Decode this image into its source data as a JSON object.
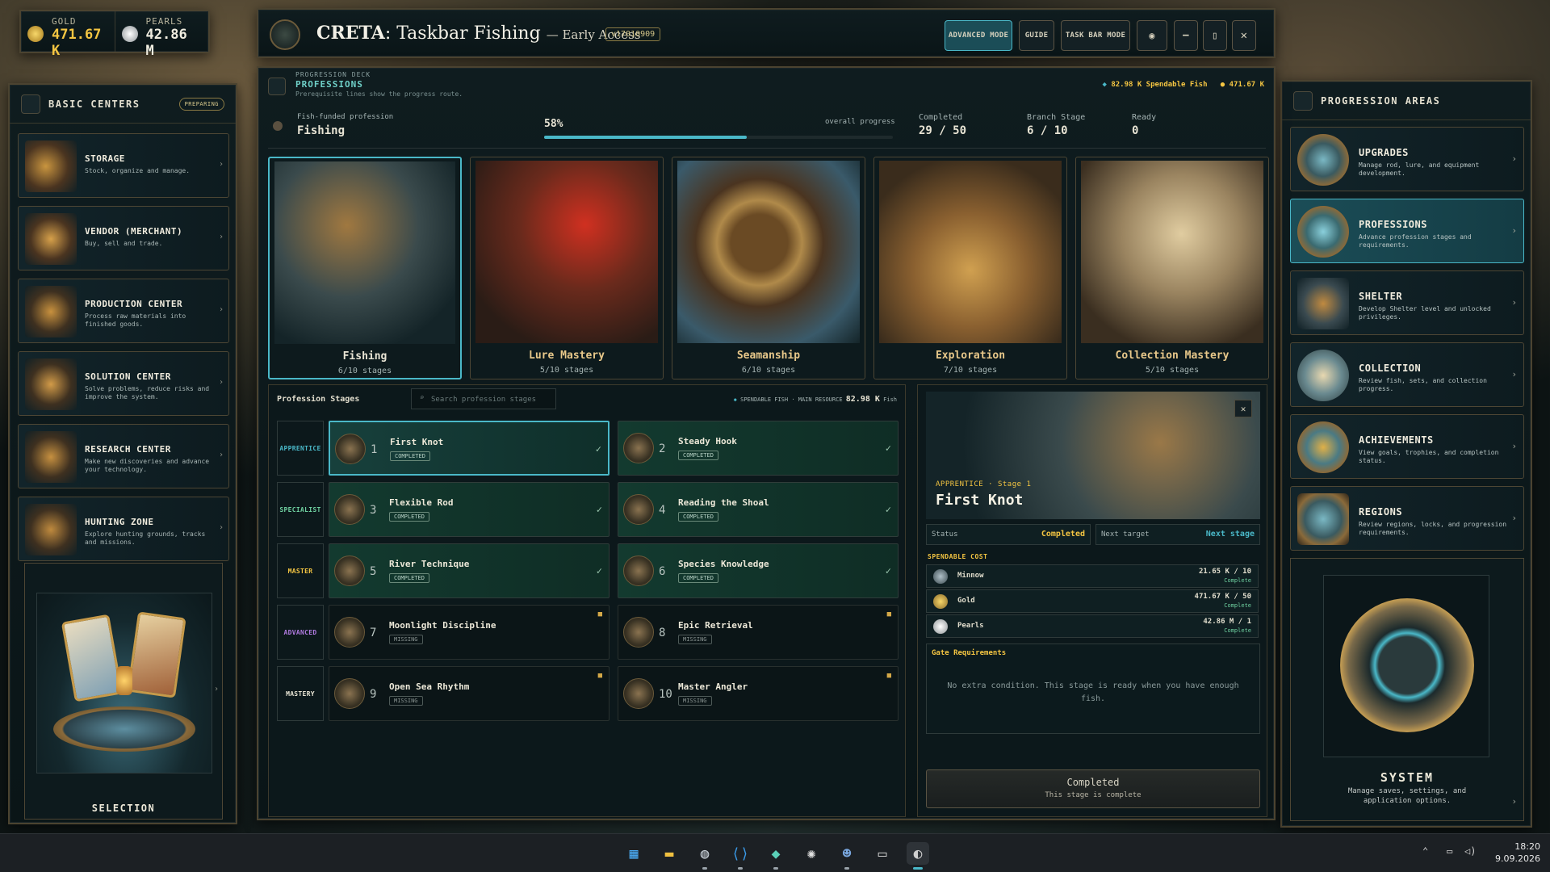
{
  "currency": {
    "gold_label": "GOLD",
    "gold_value": "471.67 K",
    "pearls_label": "PEARLS",
    "pearls_value": "42.86 M"
  },
  "window": {
    "title_bold": "CRETA",
    "title_rest": ": Taskbar Fishing",
    "title_suffix": "— Early Access",
    "version": "v17010909",
    "buttons": {
      "advanced": "ADVANCED MODE",
      "guide": "GUIDE",
      "taskbar": "TASK BAR MODE"
    }
  },
  "left": {
    "title": "BASIC CENTERS",
    "badge": "PREPARING",
    "items": [
      {
        "label": "STORAGE",
        "desc": "Stock, organize and manage."
      },
      {
        "label": "VENDOR (MERCHANT)",
        "desc": "Buy, sell and trade."
      },
      {
        "label": "PRODUCTION CENTER",
        "desc": "Process raw materials into finished goods."
      },
      {
        "label": "SOLUTION CENTER",
        "desc": "Solve problems, reduce risks and improve the system."
      },
      {
        "label": "RESEARCH CENTER",
        "desc": "Make new discoveries and advance your technology."
      },
      {
        "label": "HUNTING ZONE",
        "desc": "Explore hunting grounds, tracks and missions."
      }
    ],
    "selection_label": "SELECTION"
  },
  "right": {
    "title": "PROGRESSION AREAS",
    "items": [
      {
        "label": "UPGRADES",
        "desc": "Manage rod, lure, and equipment development."
      },
      {
        "label": "PROFESSIONS",
        "desc": "Advance profession stages and requirements."
      },
      {
        "label": "SHELTER",
        "desc": "Develop Shelter level and unlocked privileges."
      },
      {
        "label": "COLLECTION",
        "desc": "Review fish, sets, and collection progress."
      },
      {
        "label": "ACHIEVEMENTS",
        "desc": "View goals, trophies, and completion status."
      },
      {
        "label": "REGIONS",
        "desc": "Review regions, locks, and progression requirements."
      }
    ],
    "system_label": "SYSTEM",
    "system_desc": "Manage saves, settings, and application options."
  },
  "main": {
    "deck_label": "PROGRESSION DECK",
    "section": "PROFESSIONS",
    "hint": "Prerequisite lines show the progress route.",
    "spendable": "82.98 K Spendable Fish",
    "gold": "471.67 K",
    "funded_label": "Fish-funded profession",
    "funded_value": "Fishing",
    "progress_pct": "58%",
    "progress_fraction": 0.58,
    "overall_label": "overall progress",
    "completed_label": "Completed",
    "completed_value": "29 / 50",
    "branch_label": "Branch Stage",
    "branch_value": "6 / 10",
    "ready_label": "Ready",
    "ready_value": "0",
    "professions": [
      {
        "name": "Fishing",
        "stages": "6/10 stages"
      },
      {
        "name": "Lure Mastery",
        "stages": "5/10 stages"
      },
      {
        "name": "Seamanship",
        "stages": "6/10 stages"
      },
      {
        "name": "Exploration",
        "stages": "7/10 stages"
      },
      {
        "name": "Collection Mastery",
        "stages": "5/10 stages"
      }
    ],
    "stages_title": "Profession Stages",
    "search_placeholder": "Search profession stages",
    "resource_label": "SPENDABLE FISH · MAIN RESOURCE",
    "resource_value": "82.98 K",
    "resource_unit": "Fish",
    "tiers": [
      "APPRENTICE",
      "SPECIALIST",
      "MASTER",
      "ADVANCED",
      "MASTERY"
    ],
    "stages": [
      {
        "n": "1",
        "name": "First Knot",
        "status": "COMPLETED"
      },
      {
        "n": "2",
        "name": "Steady Hook",
        "status": "COMPLETED"
      },
      {
        "n": "3",
        "name": "Flexible Rod",
        "status": "COMPLETED"
      },
      {
        "n": "4",
        "name": "Reading the Shoal",
        "status": "COMPLETED"
      },
      {
        "n": "5",
        "name": "River Technique",
        "status": "COMPLETED"
      },
      {
        "n": "6",
        "name": "Species Knowledge",
        "status": "COMPLETED"
      },
      {
        "n": "7",
        "name": "Moonlight Discipline",
        "status": "MISSING"
      },
      {
        "n": "8",
        "name": "Epic Retrieval",
        "status": "MISSING"
      },
      {
        "n": "9",
        "name": "Open Sea Rhythm",
        "status": "MISSING"
      },
      {
        "n": "10",
        "name": "Master Angler",
        "status": "MISSING"
      }
    ]
  },
  "detail": {
    "tag": "APPRENTICE · Stage 1",
    "title": "First Knot",
    "status_label": "Status",
    "status_value": "Completed",
    "next_label": "Next target",
    "next_value": "Next stage",
    "cost_title": "SPENDABLE COST",
    "costs": [
      {
        "name": "Minnow",
        "qty": "21.65 K / 10",
        "state": "Complete"
      },
      {
        "name": "Gold",
        "qty": "471.67 K / 50",
        "state": "Complete"
      },
      {
        "name": "Pearls",
        "qty": "42.86 M / 1",
        "state": "Complete"
      }
    ],
    "gate_title": "Gate Requirements",
    "gate_text": "No extra condition. This stage is ready when you have enough fish.",
    "footer_title": "Completed",
    "footer_sub": "This stage is complete"
  },
  "system_tray": {
    "time": "18:20",
    "date": "9.09.2026"
  },
  "colors": {
    "accent": "#4ab8c8",
    "gold": "#f4c542",
    "completed_green": "#6fd0a0"
  }
}
